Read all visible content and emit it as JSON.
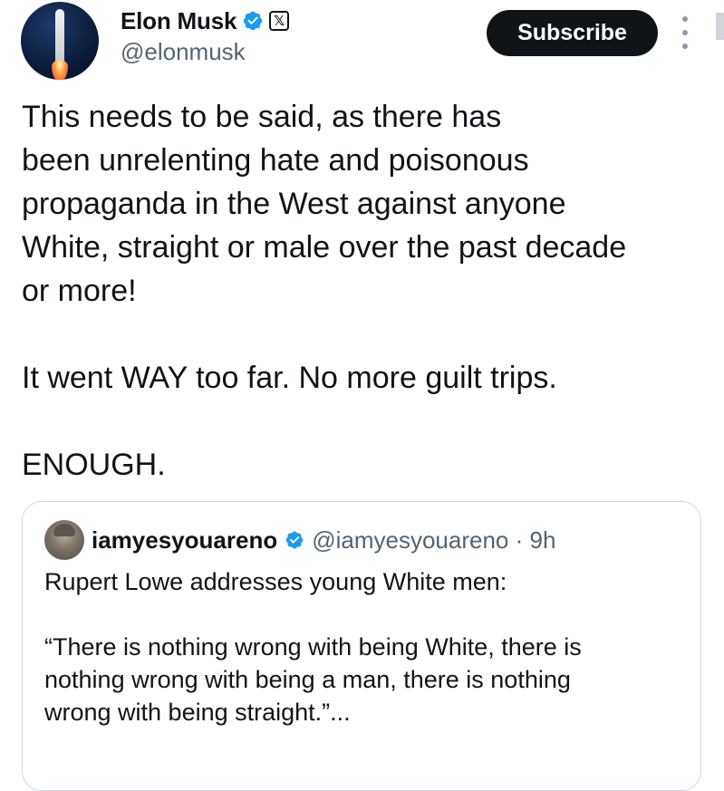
{
  "post": {
    "author": {
      "name": "Elon Musk",
      "handle": "@elonmusk",
      "avatar": "rocket-launch-avatar",
      "badges": [
        "verified-icon",
        "x-affiliate-icon"
      ],
      "affiliate_badge_label": "𝕏"
    },
    "subscribe_label": "Subscribe",
    "more_icon": "more-vertical-icon",
    "text": "This needs to be said, as there has\nbeen unrelenting hate and poisonous\npropaganda in the West against anyone\nWhite, straight or male over the past decade\nor more!\n\nIt went WAY too far. No more guilt trips.\n\nENOUGH."
  },
  "quoted_post": {
    "author": {
      "name": "iamyesyouareno",
      "handle": "@iamyesyouareno",
      "avatar": "user-avatar",
      "badge": "verified-icon"
    },
    "meta": "@iamyesyouareno · 9h",
    "text": "Rupert Lowe addresses young White men:\n\n“There is nothing wrong with being White, there is\nnothing wrong with being a man, there is nothing\nwrong with being straight.”..."
  },
  "colors": {
    "text_primary": "#0f1419",
    "text_secondary": "#536471",
    "verified_blue": "#1d9bf0",
    "button_bg": "#0f1419",
    "border": "#cfd9de"
  }
}
